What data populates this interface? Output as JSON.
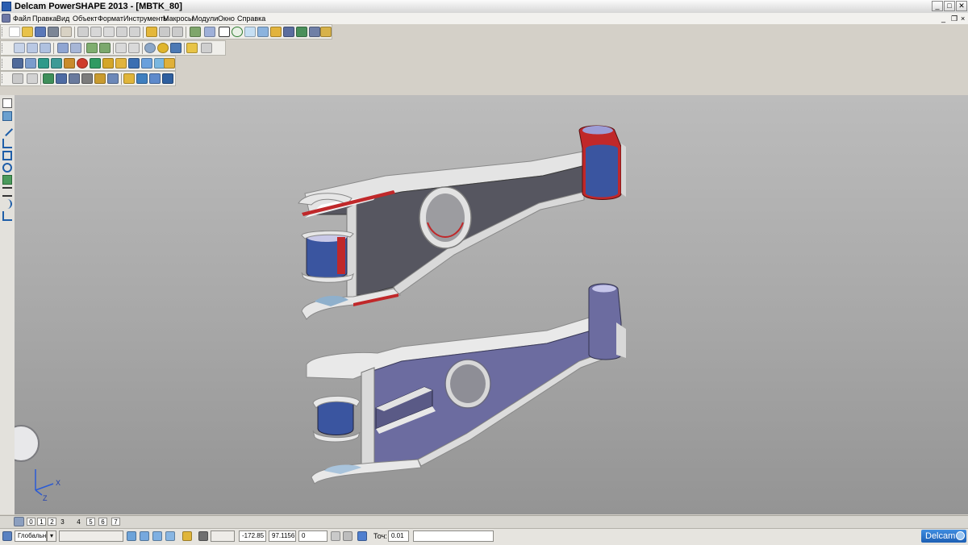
{
  "window": {
    "title": "Delcam PowerSHAPE 2013 - [MBTK_80]",
    "controls": [
      "_",
      "□",
      "✕"
    ]
  },
  "menu": [
    "Файл",
    "Правка",
    "Вид",
    "Объект",
    "Формат",
    "Инструменты",
    "Макросы",
    "Модули",
    "Окно",
    "Справка"
  ],
  "colors": {
    "viewport_top": "#bcbcbc",
    "viewport_bottom": "#949494",
    "part_face_dark": "#5c5c64",
    "part_face_lavender": "#6c6ca0",
    "part_edge_light": "#e8e8e8",
    "section_red": "#c0282a",
    "bushing_blue": "#3a55a0"
  },
  "toolbars": {
    "main_icons": [
      "new-icon",
      "open-icon",
      "save-icon",
      "print-icon",
      "cut-icon",
      "copy-icon",
      "paste-icon",
      "undo-icon",
      "redo-icon",
      "select-icon",
      "line-icon",
      "arc-icon",
      "surface-icon"
    ],
    "view_icons": [
      "view-front-icon",
      "view-top-icon",
      "view-iso-icon",
      "zoom-icon",
      "zoom-window-icon",
      "rotate-icon",
      "shade-icon",
      "wireframe-icon"
    ],
    "surface_icons": [
      "surface-plane-icon",
      "surface-cylinder-icon",
      "surface-sphere-icon",
      "surface-cone-icon",
      "surface-torus-icon"
    ],
    "solid_icons": [
      "solid-block-icon",
      "solid-cylinder-icon",
      "solid-extrude-icon",
      "solid-revolve-icon",
      "solid-boolean-icon"
    ]
  },
  "left_tools": [
    "select-arrow-icon",
    "object-icon",
    "line-tool-icon",
    "multi-line-icon",
    "rectangle-icon",
    "circle-icon",
    "solid-tool-icon",
    "dimension-icon",
    "arc-tool-icon",
    "angle-icon"
  ],
  "viewport": {
    "axis_x_label": "X",
    "axis_z_label": "Z"
  },
  "levels": {
    "items": [
      "0",
      "1",
      "2",
      "3",
      "4",
      "5",
      "6",
      "7"
    ]
  },
  "status": {
    "workplane": "Глобальна",
    "empty_select": "",
    "empty_field": "",
    "coord_x": "-172.85",
    "coord_y": "97.1156",
    "coord_z": "0",
    "tolerance_label": "Точ:",
    "tolerance_value": "0.01",
    "message": "",
    "logo": "Delcam"
  }
}
